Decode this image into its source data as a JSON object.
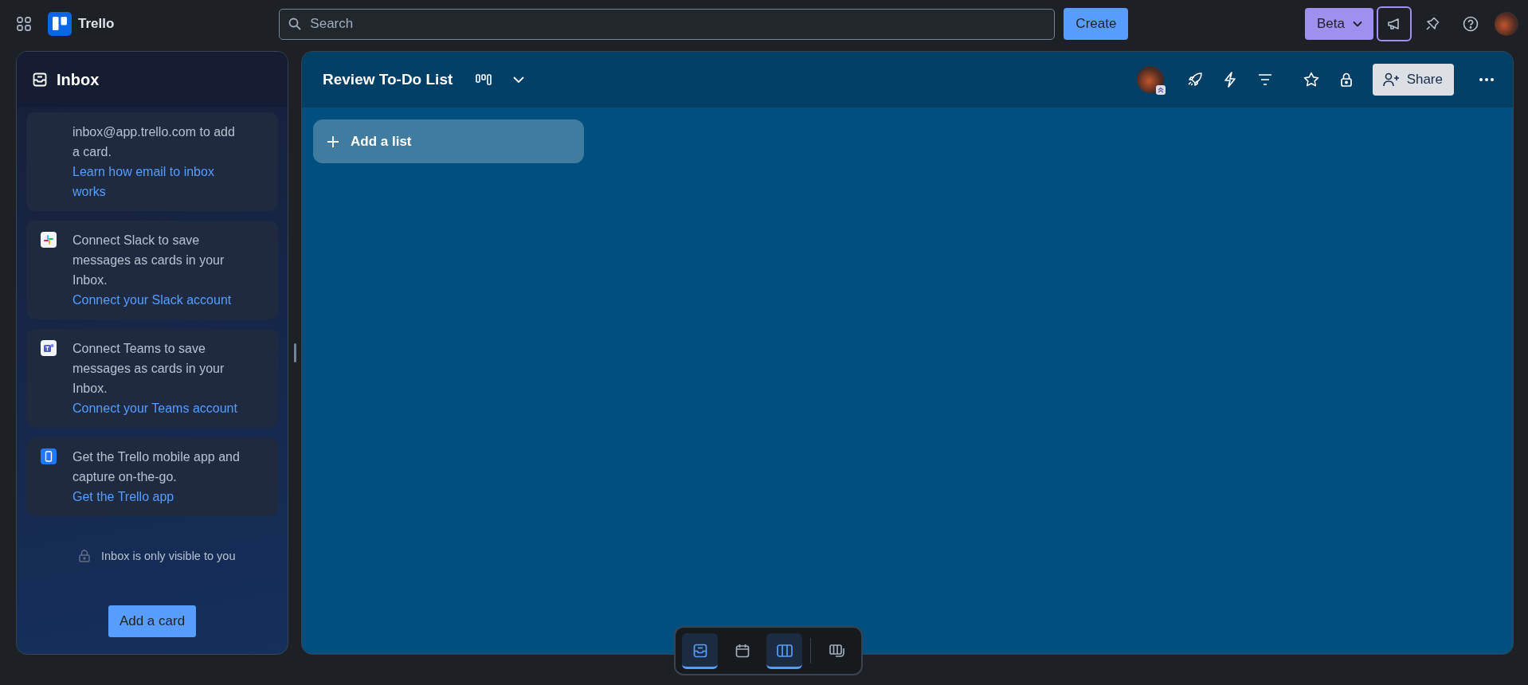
{
  "topbar": {
    "app_name": "Trello",
    "search": {
      "placeholder": "Search"
    },
    "create_button": "Create",
    "beta_button": "Beta",
    "announcements_selected": true
  },
  "inbox": {
    "title": "Inbox",
    "cards": [
      {
        "kind": "email",
        "text": "inbox@app.trello.com to add a card.",
        "link": "Learn how email to inbox works"
      },
      {
        "kind": "slack",
        "text": "Connect Slack to save messages as cards in your Inbox.",
        "link": "Connect your Slack account"
      },
      {
        "kind": "teams",
        "text": "Connect Teams to save messages as cards in your Inbox.",
        "link": "Connect your Teams account"
      },
      {
        "kind": "mobile",
        "text": "Get the Trello mobile app and capture on-the-go.",
        "link": "Get the Trello app"
      }
    ],
    "privacy_note": "Inbox is only visible to you",
    "add_button": "Add a card"
  },
  "board": {
    "title": "Review To-Do List",
    "share_button": "Share",
    "add_list": "Add a list"
  },
  "view_switcher": [
    {
      "kind": "inbox",
      "selected": true
    },
    {
      "kind": "planner",
      "selected": false
    },
    {
      "kind": "board",
      "selected": true
    },
    {
      "kind": "switch",
      "selected": false
    }
  ]
}
